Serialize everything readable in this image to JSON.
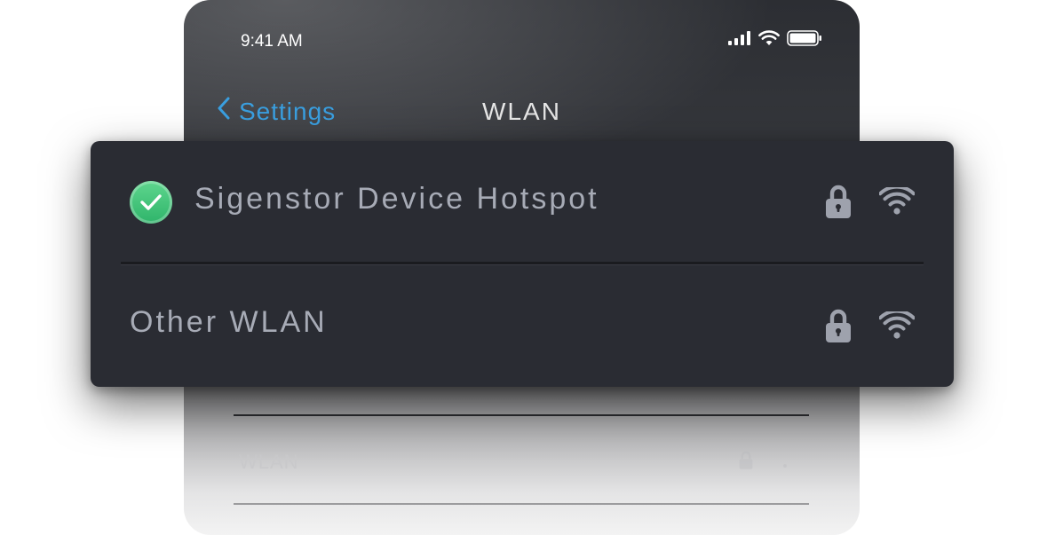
{
  "status_bar": {
    "time": "9:41 AM",
    "icons": [
      "cellular-signal-icon",
      "wifi-signal-icon",
      "battery-icon"
    ]
  },
  "nav": {
    "back_label": "Settings",
    "back_icon": "chevron-left-icon",
    "title": "WLAN"
  },
  "networks": [
    {
      "name": "Sigenstor Device Hotspot",
      "connected": true,
      "status_icon": "checkmark-circle-icon",
      "icons": [
        "lock-icon",
        "wifi-icon"
      ]
    },
    {
      "name": "Other WLAN",
      "connected": false,
      "icons": [
        "lock-icon",
        "wifi-icon"
      ]
    }
  ],
  "background_list": {
    "row_label": "WLAN",
    "icons": [
      "lock-icon",
      "wifi-icon"
    ]
  },
  "colors": {
    "accent_blue": "#3a9fe0",
    "connected_green": "#3cc077",
    "card_background": "#2a2c33",
    "text_muted": "#a7abb6"
  }
}
